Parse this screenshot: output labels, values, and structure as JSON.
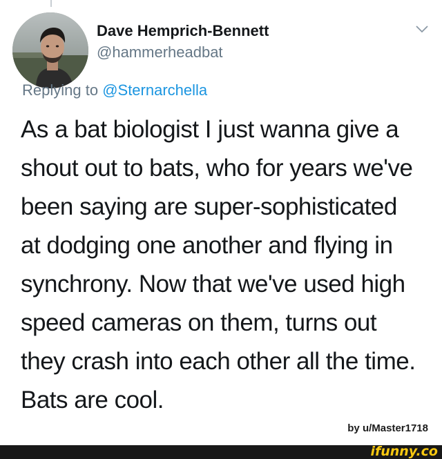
{
  "author": {
    "display_name": "Dave Hemprich-Bennett",
    "handle": "@hammerheadbat",
    "avatar": "profile-photo"
  },
  "menu_icon": "chevron-down-icon",
  "reply": {
    "prefix": "Replying to ",
    "mention": "@Sternarchella"
  },
  "tweet": {
    "lines": [
      "As a bat biologist I just wanna give a",
      "shout out to bats, who for years we've",
      "been saying are super-sophisticated",
      "at dodging one another and flying in",
      "synchrony. Now that we've used high",
      "speed cameras on them, turns out",
      "they crash into each other all the time.",
      "Bats are cool."
    ]
  },
  "credit": "by u/Master1718",
  "watermark": "ifunny.co",
  "colors": {
    "text": "#14171a",
    "secondary": "#657786",
    "link": "#1b95e0",
    "watermark": "#f8c810",
    "footer": "#181818"
  }
}
